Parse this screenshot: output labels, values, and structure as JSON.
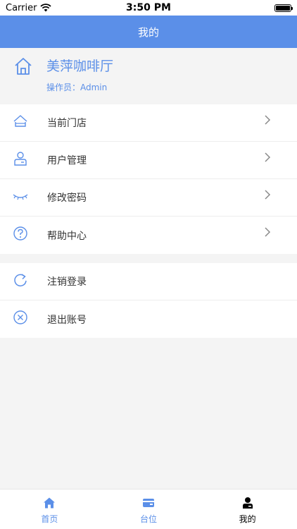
{
  "status_bar": {
    "carrier": "Carrier",
    "time": "3:50 PM"
  },
  "nav": {
    "title": "我的"
  },
  "profile": {
    "store_name": "美萍咖啡厅",
    "operator": "操作员：Admin",
    "icon": "home-icon"
  },
  "menu_group_1": [
    {
      "label": "当前门店",
      "icon": "store-icon"
    },
    {
      "label": "用户管理",
      "icon": "user-icon"
    },
    {
      "label": "修改密码",
      "icon": "eye-closed-icon"
    },
    {
      "label": "帮助中心",
      "icon": "help-icon"
    }
  ],
  "menu_group_2": [
    {
      "label": "注销登录",
      "icon": "refresh-icon"
    },
    {
      "label": "退出账号",
      "icon": "close-circle-icon"
    }
  ],
  "tabs": [
    {
      "label": "首页",
      "icon": "home-icon",
      "active": false
    },
    {
      "label": "台位",
      "icon": "card-icon",
      "active": false
    },
    {
      "label": "我的",
      "icon": "person-icon",
      "active": true
    }
  ],
  "colors": {
    "accent": "#5b8fe8",
    "background": "#f4f4f4",
    "active_tab": "#000000"
  }
}
